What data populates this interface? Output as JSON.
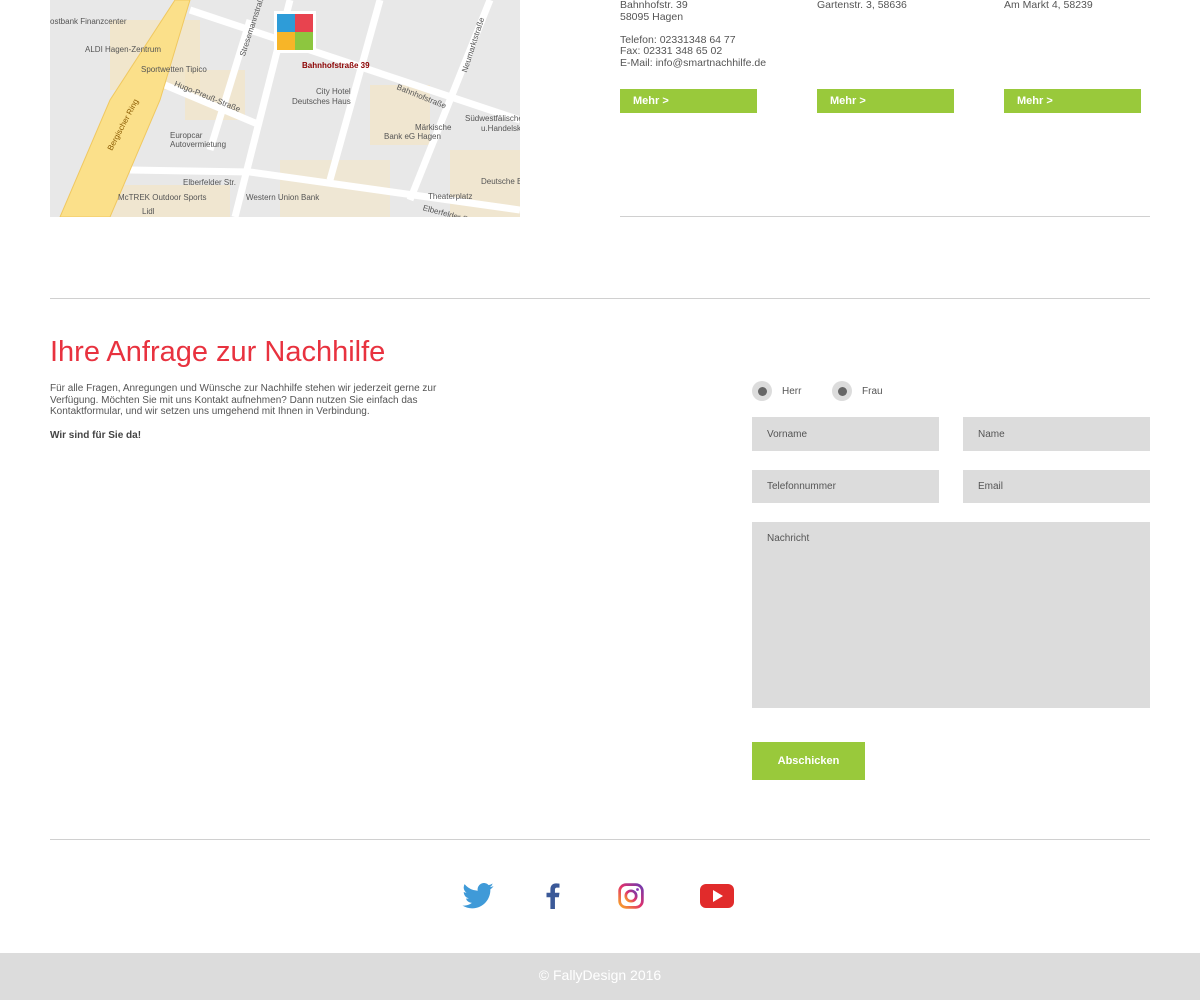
{
  "map": {
    "pin_label": "Bahnhofstraße 39",
    "labels": [
      "ostbank Finanzcenter",
      "ALDI Hagen-Zentrum",
      "Sportwetten Tipico",
      "Hugo-Preuß-Straße",
      "Stresemannstraße",
      "City Hotel",
      "Deutsches Haus",
      "Bahnhofstraße",
      "Neumarktstraße",
      "Südwestfälische",
      "u.Handelsk",
      "Märkische",
      "Bank eG Hagen",
      "Europcar",
      "Autovermietung",
      "Bergischer Ring",
      "Elberfelder Str.",
      "Western Union Bank",
      "McTREK Outdoor Sports",
      "Lidl",
      "Theaterplatz",
      "Deutsche B",
      "Elberfelder Str."
    ]
  },
  "locations": [
    {
      "lines": [
        "Bahnhofstr. 39",
        "58095 Hagen",
        "",
        "Telefon: 02331348 64 77",
        "Fax:  02331 348 65 02",
        "E-Mail: info@smartnachhilfe.de"
      ],
      "button": "Mehr >"
    },
    {
      "lines": [
        "Gartenstr. 3, 58636"
      ],
      "button": "Mehr >"
    },
    {
      "lines": [
        "Am Markt 4, 58239"
      ],
      "button": "Mehr >"
    }
  ],
  "inquiry": {
    "title": "Ihre Anfrage zur Nachhilfe",
    "intro": "Für alle Fragen, Anregungen und Wünsche zur Nachhilfe stehen wir jederzeit gerne zur Verfügung. Möchten Sie mit uns Kontakt aufnehmen? Dann nutzen Sie einfach das Kontaktformular, und wir setzen uns umgehend mit Ihnen in Verbindung.",
    "tagline": "Wir sind für Sie da!"
  },
  "form": {
    "salutation_options": [
      "Herr",
      "Frau"
    ],
    "firstname_placeholder": "Vorname",
    "name_placeholder": "Name",
    "phone_placeholder": "Telefonnummer",
    "email_placeholder": "Email",
    "message_placeholder": "Nachricht",
    "submit": "Abschicken"
  },
  "social": [
    "twitter-icon",
    "facebook-icon",
    "instagram-icon",
    "youtube-icon"
  ],
  "footer": {
    "copyright": "© FallyDesign 2016"
  },
  "colors": {
    "accent_green": "#99c93b",
    "title_red": "#e8323f",
    "footer_bg": "#dcdcdc"
  }
}
